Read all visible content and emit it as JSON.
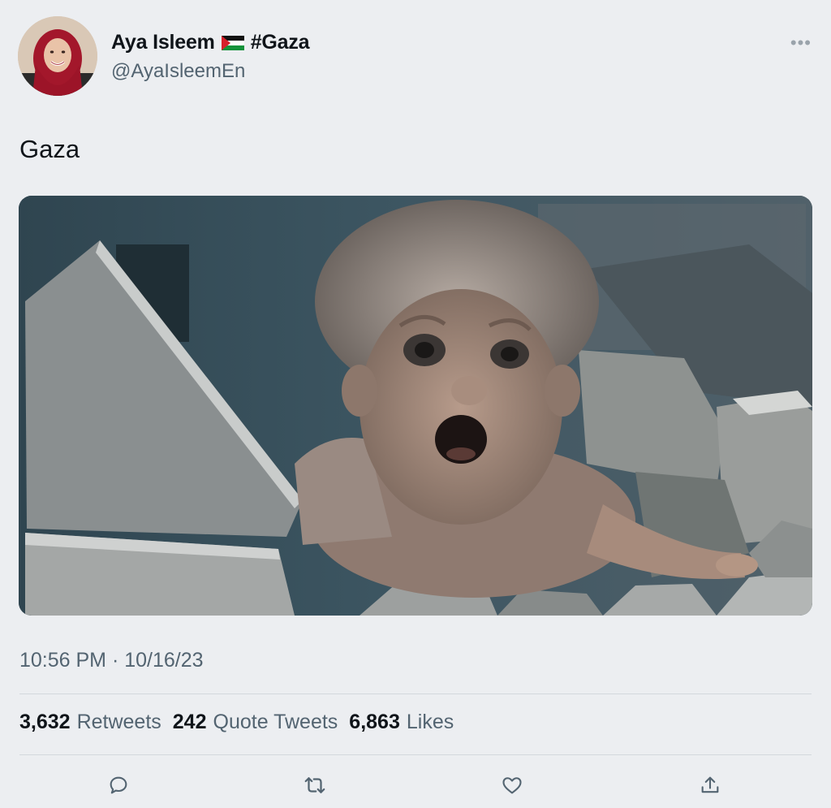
{
  "user": {
    "display_name": "Aya Isleem",
    "flag": "palestine-flag-icon",
    "hashtag": "#Gaza",
    "handle": "@AyaIsleemEn"
  },
  "tweet": {
    "text": "Gaza",
    "time": "10:56 PM",
    "separator": "·",
    "date": "10/16/23"
  },
  "stats": {
    "retweets_count": "3,632",
    "retweets_label": "Retweets",
    "quotes_count": "242",
    "quotes_label": "Quote Tweets",
    "likes_count": "6,863",
    "likes_label": "Likes"
  },
  "actions": {
    "icons": [
      "reply-icon",
      "retweet-icon",
      "like-icon",
      "share-icon"
    ]
  },
  "colors": {
    "background": "#eceef1",
    "text": "#0f1419",
    "secondary_text": "#536471",
    "hijab": "#a3172b"
  }
}
